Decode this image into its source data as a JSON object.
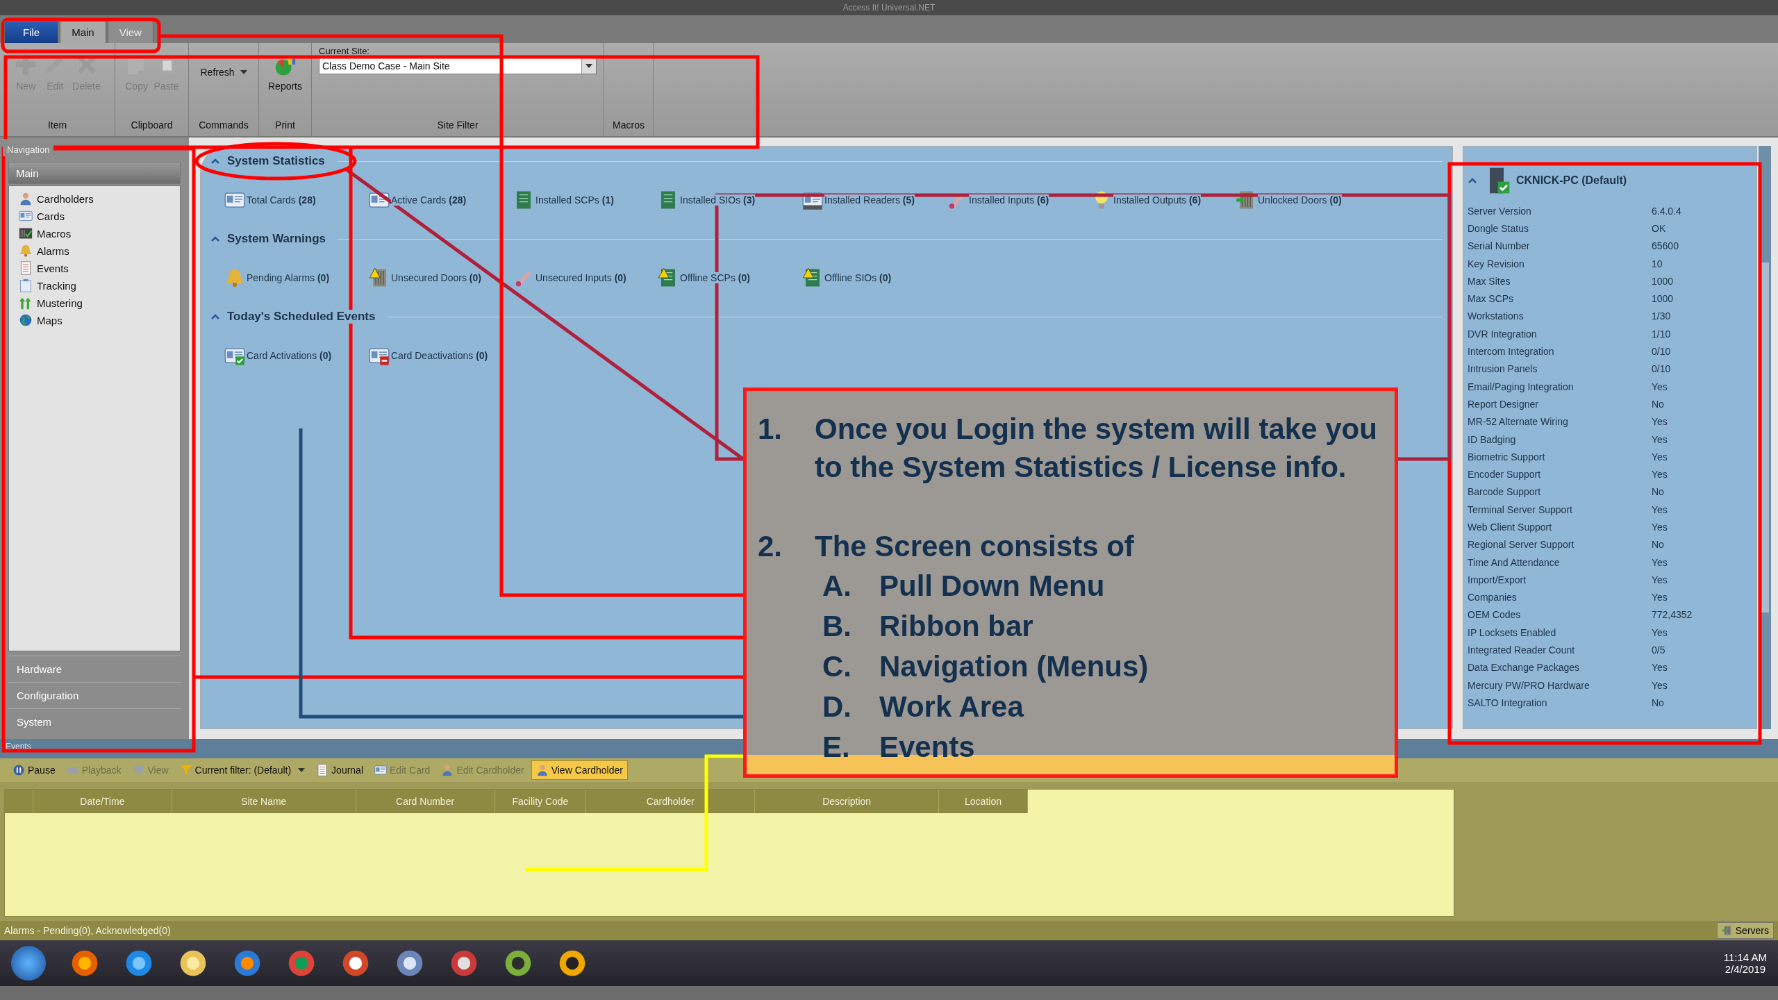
{
  "window": {
    "title": "Access It! Universal.NET"
  },
  "menu_tabs": [
    {
      "label": "File",
      "kind": "file",
      "selected": false
    },
    {
      "label": "Main",
      "kind": "tab",
      "selected": true
    },
    {
      "label": "View",
      "kind": "tab",
      "selected": false
    }
  ],
  "ribbon": {
    "groups": [
      {
        "label": "Item",
        "kind": "buttons",
        "buttons": [
          {
            "label": "New",
            "disabled": true,
            "dropdown": false
          },
          {
            "label": "Edit",
            "disabled": true,
            "dropdown": false
          },
          {
            "label": "Delete",
            "disabled": true,
            "dropdown": false
          }
        ]
      },
      {
        "label": "Clipboard",
        "kind": "buttons",
        "buttons": [
          {
            "label": "Copy",
            "disabled": true,
            "dropdown": false
          },
          {
            "label": "Paste",
            "disabled": true,
            "dropdown": false
          }
        ]
      },
      {
        "label": "Commands",
        "kind": "buttons",
        "buttons": [
          {
            "label": "Refresh",
            "disabled": false,
            "dropdown": true
          }
        ]
      },
      {
        "label": "Print",
        "kind": "buttons",
        "buttons": [
          {
            "label": "Reports",
            "disabled": false,
            "dropdown": false
          }
        ]
      },
      {
        "label": "Site Filter",
        "kind": "site",
        "field_label": "Current Site:",
        "value": "Class Demo Case - Main Site"
      },
      {
        "label": "Macros",
        "kind": "empty"
      }
    ]
  },
  "navigation": {
    "title": "Navigation",
    "section": "Main",
    "items": [
      {
        "label": "Cardholders"
      },
      {
        "label": "Cards"
      },
      {
        "label": "Macros"
      },
      {
        "label": "Alarms"
      },
      {
        "label": "Events"
      },
      {
        "label": "Tracking"
      },
      {
        "label": "Mustering"
      },
      {
        "label": "Maps"
      }
    ],
    "sections": [
      "Hardware",
      "Configuration",
      "System"
    ]
  },
  "work_sections": [
    {
      "title": "System Statistics",
      "expanded": true,
      "items": [
        {
          "label": "Total Cards",
          "count": "(28)"
        },
        {
          "label": "Active Cards",
          "count": "(28)"
        },
        {
          "label": "Installed SCPs",
          "count": "(1)"
        },
        {
          "label": "Installed SIOs",
          "count": "(3)"
        },
        {
          "label": "Installed Readers",
          "count": "(5)"
        },
        {
          "label": "Installed Inputs",
          "count": "(6)"
        },
        {
          "label": "Installed Outputs",
          "count": "(6)"
        },
        {
          "label": "Unlocked Doors",
          "count": "(0)"
        }
      ]
    },
    {
      "title": "System Warnings",
      "expanded": true,
      "items": [
        {
          "label": "Pending Alarms",
          "count": "(0)"
        },
        {
          "label": "Unsecured Doors",
          "count": "(0)"
        },
        {
          "label": "Unsecured Inputs",
          "count": "(0)"
        },
        {
          "label": "Offline SCPs",
          "count": "(0)"
        },
        {
          "label": "Offline SIOs",
          "count": "(0)"
        }
      ]
    },
    {
      "title": "Today's Scheduled Events",
      "expanded": true,
      "items": [
        {
          "label": "Card Activations",
          "count": "(0)"
        },
        {
          "label": "Card Deactivations",
          "count": "(0)"
        }
      ]
    }
  ],
  "license": {
    "title": "CKNICK-PC (Default)",
    "expanded": true,
    "rows": [
      {
        "name": "Server Version",
        "value": "6.4.0.4"
      },
      {
        "name": "Dongle Status",
        "value": "OK"
      },
      {
        "name": "Serial Number",
        "value": "65600"
      },
      {
        "name": "Key Revision",
        "value": "10"
      },
      {
        "name": "Max Sites",
        "value": "1000"
      },
      {
        "name": "Max SCPs",
        "value": "1000"
      },
      {
        "name": "Workstations",
        "value": "1/30"
      },
      {
        "name": "DVR Integration",
        "value": "1/10"
      },
      {
        "name": "Intercom Integration",
        "value": "0/10"
      },
      {
        "name": "Intrusion Panels",
        "value": "0/10"
      },
      {
        "name": "Email/Paging Integration",
        "value": "Yes"
      },
      {
        "name": "Report Designer",
        "value": "No"
      },
      {
        "name": "MR-52 Alternate Wiring",
        "value": "Yes"
      },
      {
        "name": "ID Badging",
        "value": "Yes"
      },
      {
        "name": "Biometric Support",
        "value": "Yes"
      },
      {
        "name": "Encoder Support",
        "value": "Yes"
      },
      {
        "name": "Barcode Support",
        "value": "No"
      },
      {
        "name": "Terminal Server Support",
        "value": "Yes"
      },
      {
        "name": "Web Client Support",
        "value": "Yes"
      },
      {
        "name": "Regional Server Support",
        "value": "No"
      },
      {
        "name": "Time And Attendance",
        "value": "Yes"
      },
      {
        "name": "Import/Export",
        "value": "Yes"
      },
      {
        "name": "Companies",
        "value": "Yes"
      },
      {
        "name": "OEM Codes",
        "value": "772,4352"
      },
      {
        "name": "IP Locksets Enabled",
        "value": "Yes"
      },
      {
        "name": "Integrated Reader Count",
        "value": "0/5"
      },
      {
        "name": "Data Exchange Packages",
        "value": "Yes"
      },
      {
        "name": "Mercury PW/PRO Hardware",
        "value": "Yes"
      },
      {
        "name": "SALTO Integration",
        "value": "No"
      }
    ]
  },
  "events": {
    "title": "Events",
    "toolbar": [
      {
        "label": "Pause",
        "disabled": false,
        "on": false,
        "dropdown": false
      },
      {
        "label": "Playback",
        "disabled": true,
        "on": false,
        "dropdown": false
      },
      {
        "label": "View",
        "disabled": true,
        "on": false,
        "dropdown": false
      },
      {
        "label": "Current filter:  (Default)",
        "disabled": false,
        "on": false,
        "dropdown": true
      },
      {
        "label": "Journal",
        "disabled": false,
        "on": false,
        "dropdown": false
      },
      {
        "label": "Edit Card",
        "disabled": true,
        "on": false,
        "dropdown": false
      },
      {
        "label": "Edit Cardholder",
        "disabled": true,
        "on": false,
        "dropdown": false
      },
      {
        "label": "View Cardholder",
        "disabled": false,
        "on": true,
        "dropdown": false
      }
    ],
    "columns": [
      "Date/Time",
      "Site Name",
      "Card Number",
      "Facility Code",
      "Cardholder",
      "Description",
      "Location"
    ]
  },
  "status_bar": {
    "text": "Alarms - Pending(0), Acknowledged(0)",
    "servers": "Servers"
  },
  "taskbar": {
    "time": "11:14 AM",
    "date": "2/4/2019"
  },
  "callout": {
    "points": [
      {
        "number": "1.",
        "text": "Once you Login the system will take you to the System Statistics / License info."
      },
      {
        "number": "2.",
        "text": "The Screen consists of",
        "children": [
          {
            "letter": "A.",
            "text": "Pull Down Menu"
          },
          {
            "letter": "B.",
            "text": "Ribbon bar"
          },
          {
            "letter": "C.",
            "text": "Navigation (Menus)"
          },
          {
            "letter": "D.",
            "text": "Work Area"
          },
          {
            "letter": "E.",
            "text": "Events"
          }
        ]
      }
    ]
  }
}
